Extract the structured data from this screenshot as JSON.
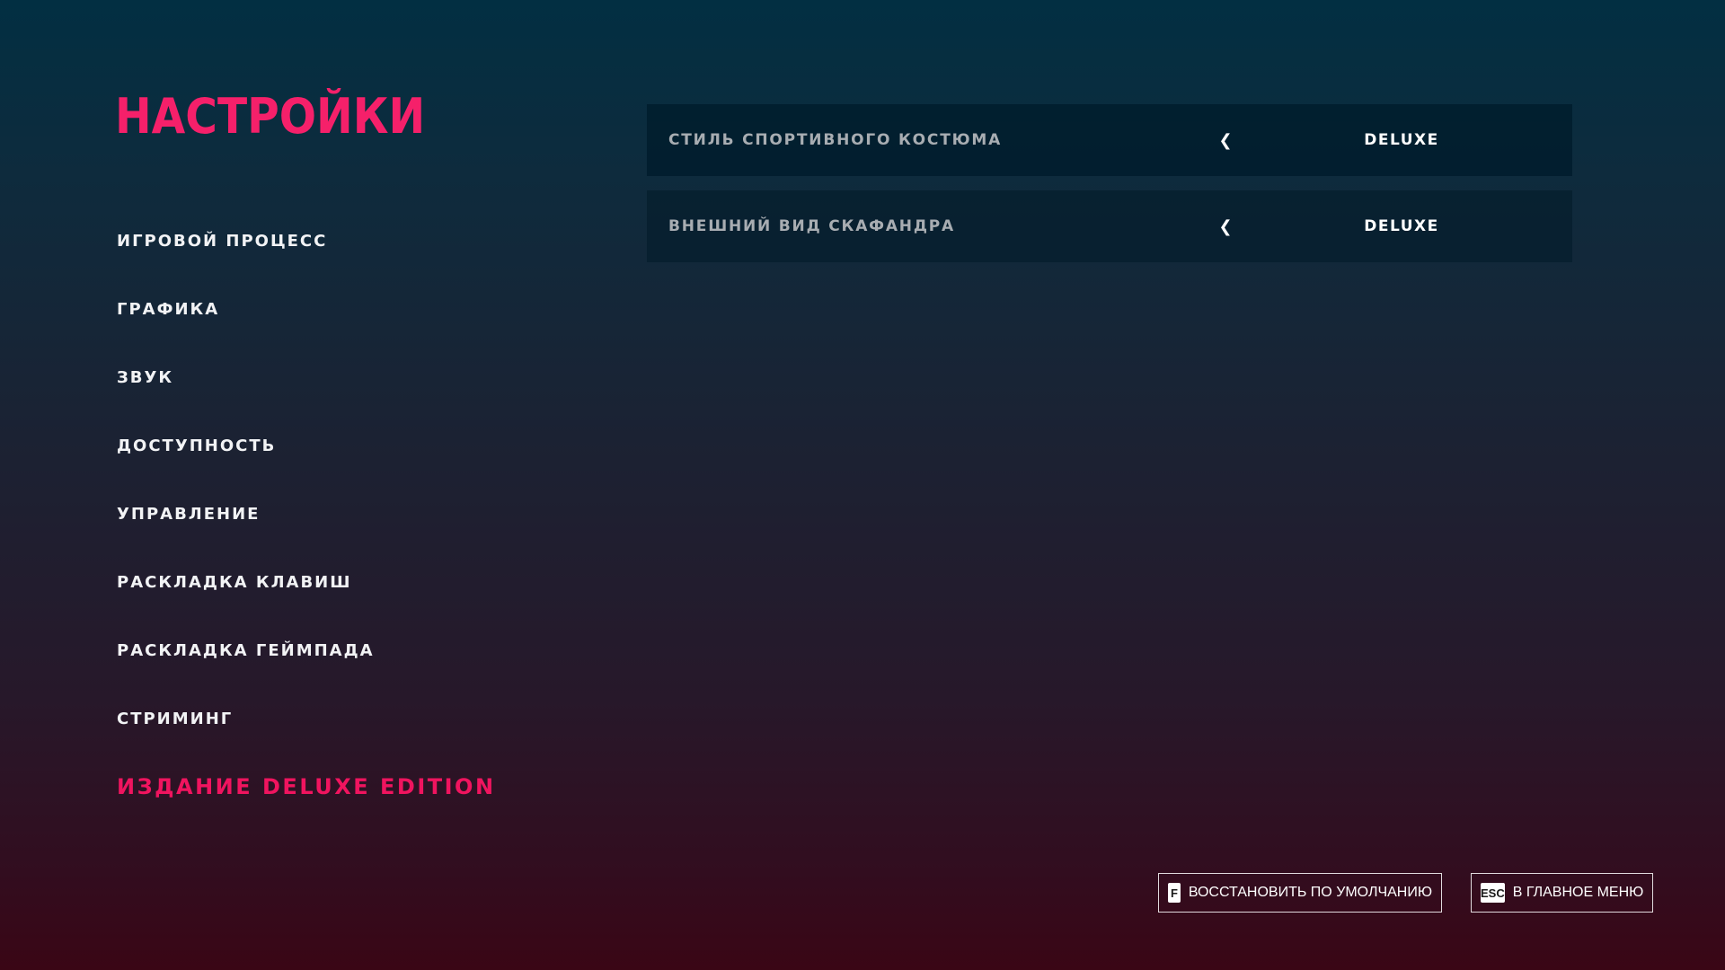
{
  "title": "НАСТРОЙКИ",
  "nav": {
    "items": [
      {
        "label": "ИГРОВОЙ ПРОЦЕСС"
      },
      {
        "label": "ГРАФИКА"
      },
      {
        "label": "ЗВУК"
      },
      {
        "label": "ДОСТУПНОСТЬ"
      },
      {
        "label": "УПРАВЛЕНИЕ"
      },
      {
        "label": "РАСКЛАДКА КЛАВИШ"
      },
      {
        "label": "РАСКЛАДКА ГЕЙМПАДА"
      },
      {
        "label": "СТРИМИНГ"
      },
      {
        "label": "ИЗДАНИЕ DELUXE EDITION",
        "active": true
      }
    ]
  },
  "options": [
    {
      "label": "СТИЛЬ СПОРТИВНОГО КОСТЮМА",
      "arrow": "❮",
      "value": "DELUXE"
    },
    {
      "label": "ВНЕШНИЙ ВИД СКАФАНДРА",
      "arrow": "❮",
      "value": "DELUXE"
    }
  ],
  "footer": {
    "restore": {
      "key": "F",
      "label": "ВОССТАНОВИТЬ ПО УМОЛЧАНИЮ"
    },
    "main_menu": {
      "key": "ESC",
      "label": "В ГЛАВНОЕ МЕНЮ"
    }
  },
  "colors": {
    "accent": "#f0145f",
    "text": "#f2f3f5",
    "option_label": "#a8adb2"
  },
  "icons": {
    "option_arrow": "chevron-left-icon"
  }
}
